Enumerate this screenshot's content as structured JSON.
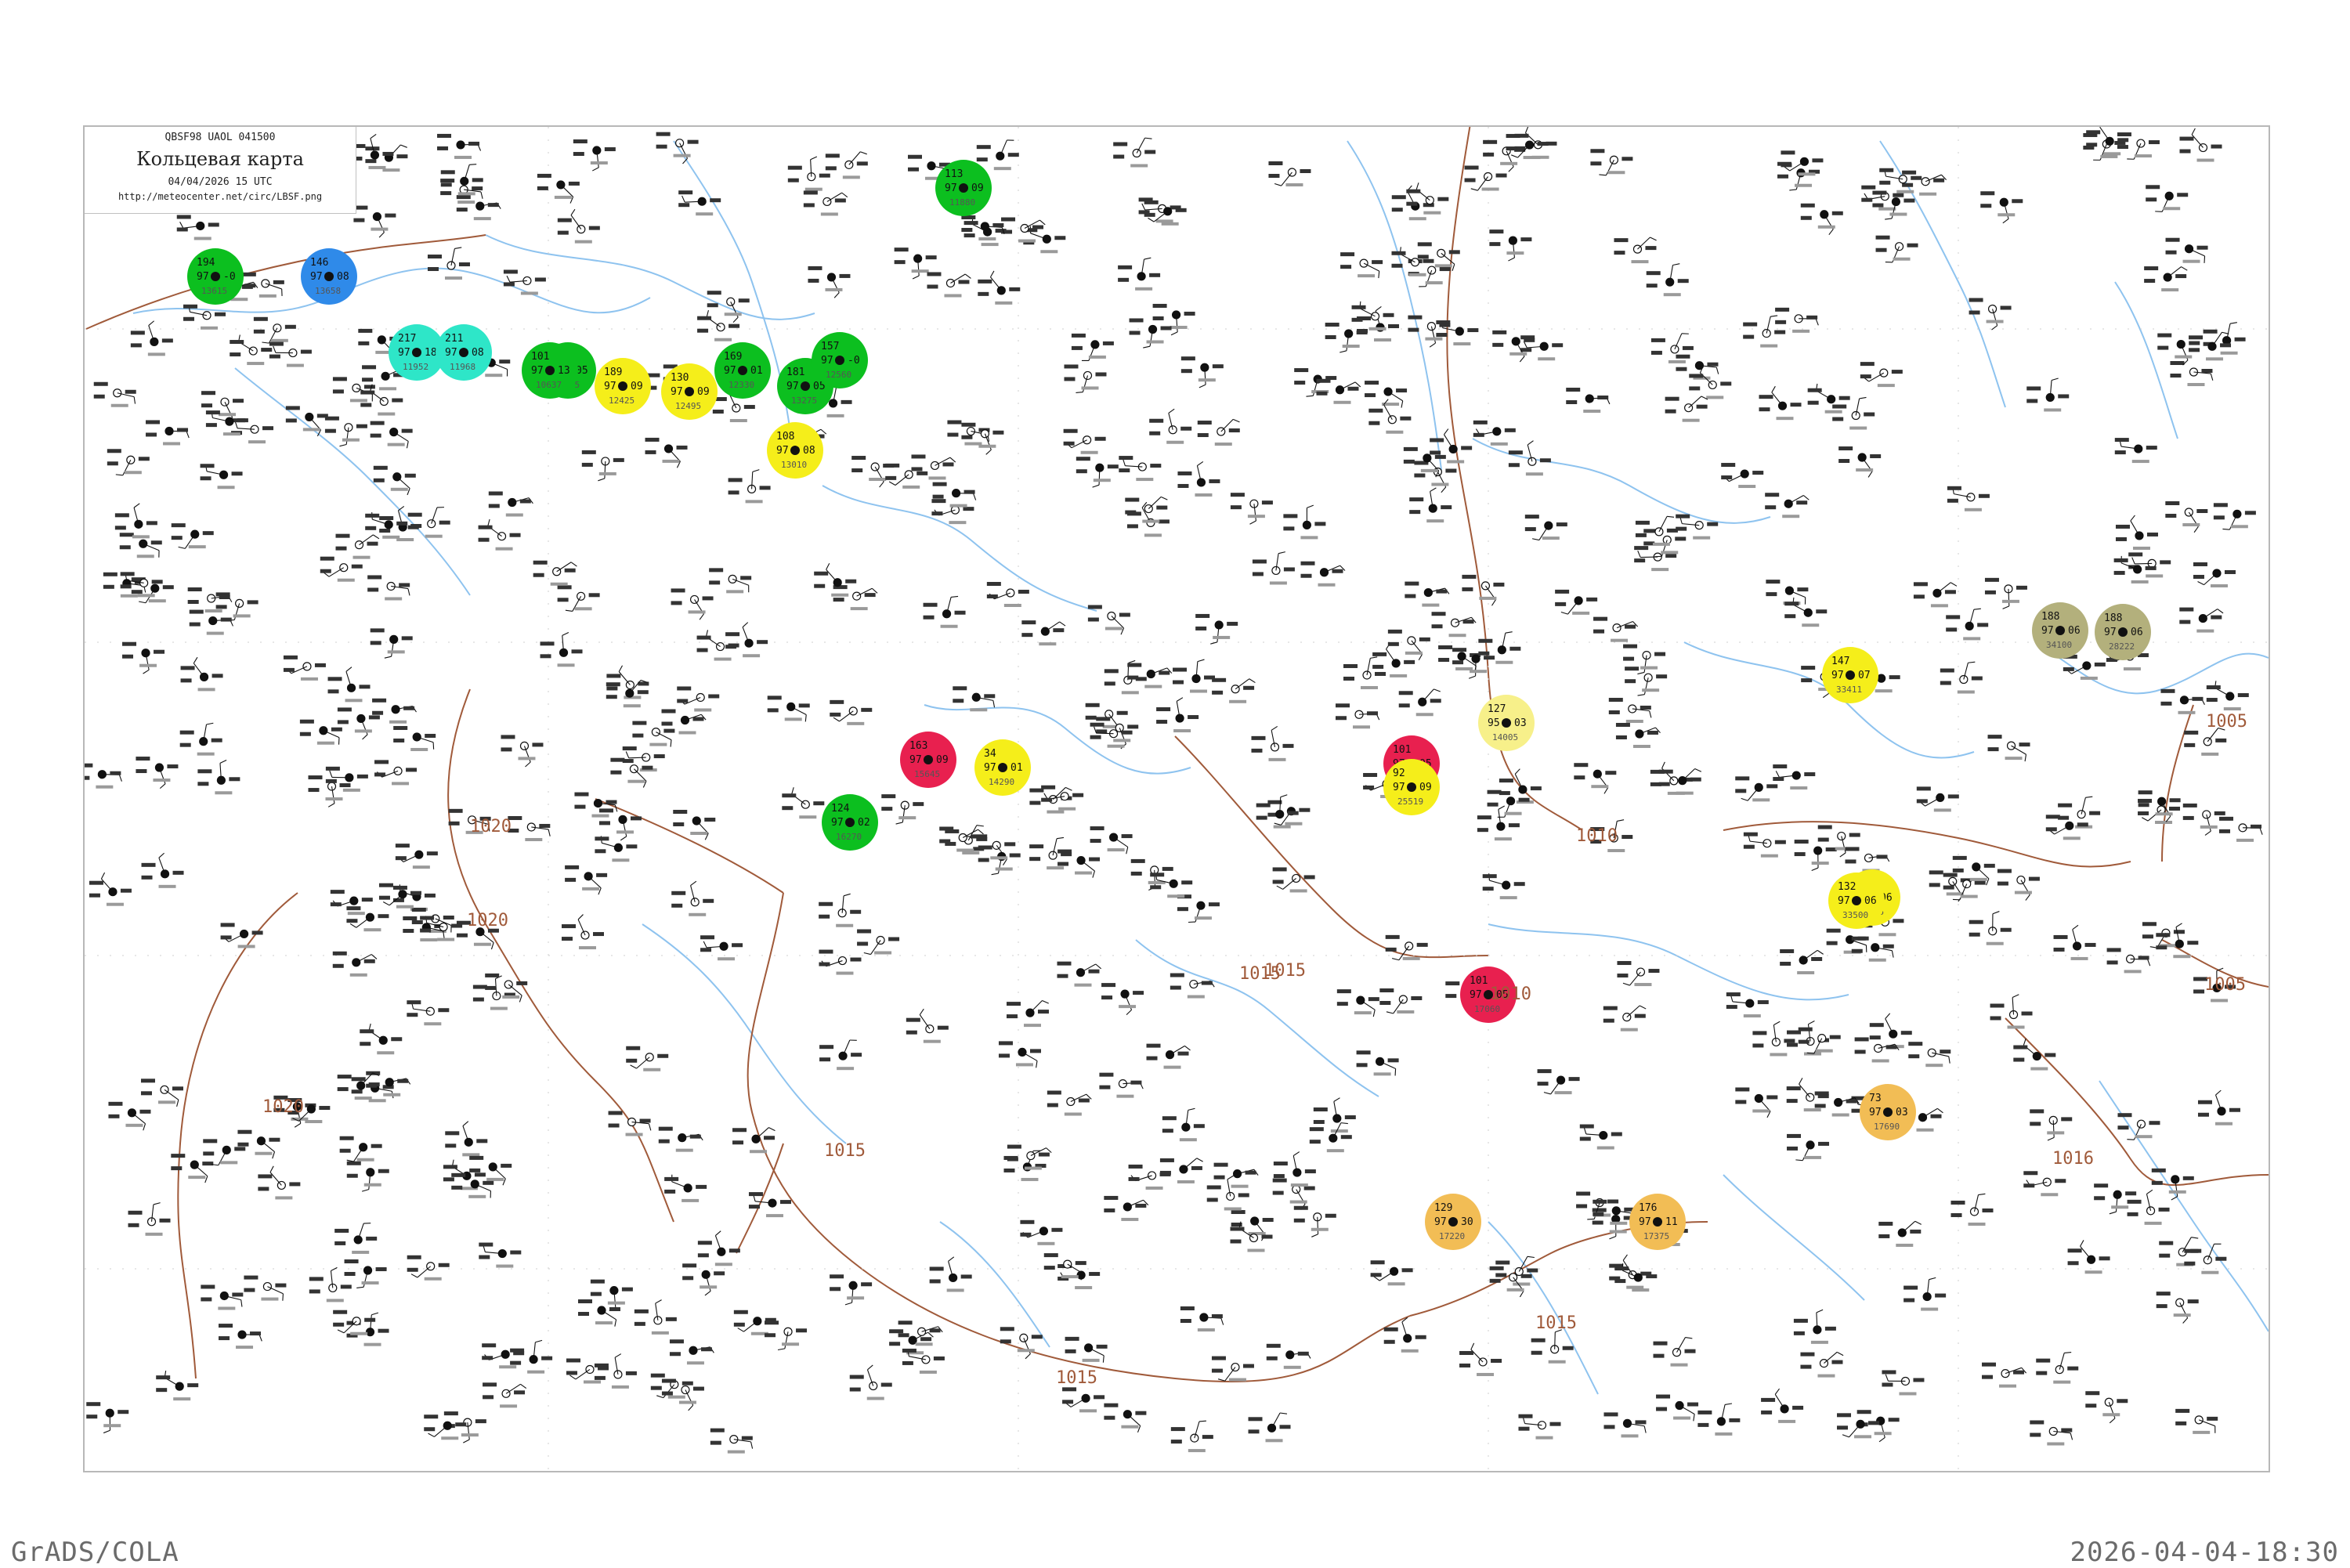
{
  "header": {
    "code_line": "QBSF98  UAOL  041500",
    "title": "Кольцевая карта",
    "date": "04/04/2026 15 UTC",
    "url": "http://meteocenter.net/circ/LBSF.png"
  },
  "footer": {
    "left": "GrADS/COLA",
    "right": "2026-04-04-18:30"
  },
  "isobars": [
    {
      "label": "1020"
    },
    {
      "label": "1020"
    },
    {
      "label": "1015"
    },
    {
      "label": "1015"
    },
    {
      "label": "1015"
    },
    {
      "label": "1015"
    },
    {
      "label": "1010"
    },
    {
      "label": "1010"
    },
    {
      "label": "1005"
    },
    {
      "label": "1005"
    },
    {
      "label": "1015"
    },
    {
      "label": "1016"
    },
    {
      "label": "1020"
    }
  ],
  "colors": {
    "green": "#0cbf1f",
    "cyan": "#2ee6c8",
    "blue": "#2f8ae9",
    "yellow": "#f5ee1a",
    "light_yellow": "#f7f08a",
    "red": "#e8204f",
    "orange": "#f2bd55",
    "olive": "#b3b07c",
    "isobar": "#a05a3a",
    "river": "#8ec3ef",
    "station": "#111111"
  },
  "stations": [
    {
      "name": "13615",
      "t": "194",
      "v": "97",
      "d": "-0",
      "fill": "green"
    },
    {
      "name": "13658",
      "t": "146",
      "v": "97",
      "d": "08",
      "fill": "blue"
    },
    {
      "name": "11952",
      "t": "217",
      "v": "97",
      "d": "18",
      "fill": "cyan"
    },
    {
      "name": "11968",
      "t": "211",
      "v": "97",
      "d": "08",
      "fill": "cyan"
    },
    {
      "name": "12375",
      "t": "181",
      "v": "97",
      "d": "05",
      "fill": "green"
    },
    {
      "name": "12495",
      "t": "130",
      "v": "97",
      "d": "09",
      "fill": "yellow"
    },
    {
      "name": "13275",
      "t": "181",
      "v": "97",
      "d": "05",
      "fill": "green"
    },
    {
      "name": "12560",
      "t": "157",
      "v": "97",
      "d": "-0",
      "fill": "green"
    },
    {
      "name": "12330",
      "t": "169",
      "v": "97",
      "d": "01",
      "fill": "green"
    },
    {
      "name": "12425",
      "t": "189",
      "v": "97",
      "d": "09",
      "fill": "yellow"
    },
    {
      "name": "10637",
      "t": "101",
      "v": "97",
      "d": "13",
      "fill": "green"
    },
    {
      "name": "13010",
      "t": "108",
      "v": "97",
      "d": "08",
      "fill": "yellow"
    },
    {
      "name": "11880",
      "t": "113",
      "v": "97",
      "d": "09",
      "fill": "green"
    },
    {
      "name": "14290",
      "t": "34",
      "v": "97",
      "d": "01",
      "fill": "yellow"
    },
    {
      "name": "15645",
      "t": "163",
      "v": "97",
      "d": "09",
      "fill": "red"
    },
    {
      "name": "16270",
      "t": "124",
      "v": "97",
      "d": "02",
      "fill": "green"
    },
    {
      "name": "25515",
      "t": "101",
      "v": "97",
      "d": "05",
      "fill": "red"
    },
    {
      "name": "25519",
      "t": "92",
      "v": "97",
      "d": "09",
      "fill": "yellow"
    },
    {
      "name": "14005",
      "t": "127",
      "v": "95",
      "d": "03",
      "fill": "light_yellow"
    },
    {
      "name": "28222",
      "t": "188",
      "v": "97",
      "d": "06",
      "fill": "olive"
    },
    {
      "name": "33411",
      "t": "147",
      "v": "97",
      "d": "07",
      "fill": "yellow"
    },
    {
      "name": "33815",
      "t": "147",
      "v": "97",
      "d": "06",
      "fill": "yellow"
    },
    {
      "name": "17060",
      "t": "101",
      "v": "97",
      "d": "05",
      "fill": "red"
    },
    {
      "name": "17220",
      "t": "129",
      "v": "97",
      "d": "30",
      "fill": "orange"
    },
    {
      "name": "17375",
      "t": "176",
      "v": "97",
      "d": "11",
      "fill": "orange"
    },
    {
      "name": "17690",
      "t": "73",
      "v": "97",
      "d": "03",
      "fill": "orange"
    },
    {
      "name": "34100",
      "t": "188",
      "v": "97",
      "d": "06",
      "fill": "olive"
    },
    {
      "name": "33500",
      "t": "132",
      "v": "97",
      "d": "06",
      "fill": "yellow"
    }
  ]
}
